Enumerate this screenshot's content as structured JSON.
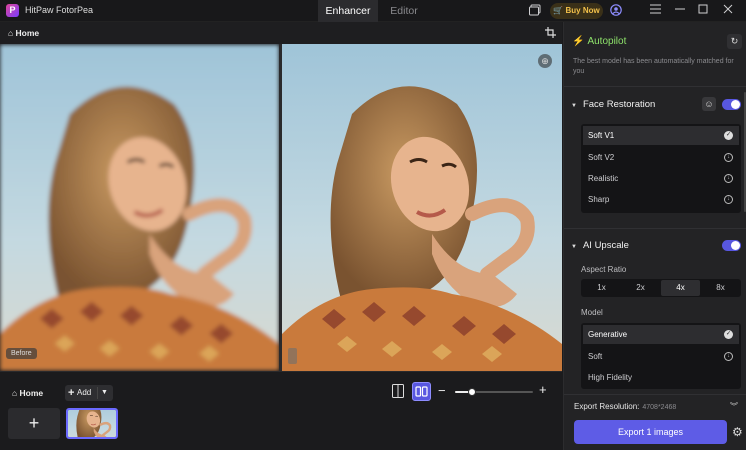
{
  "titlebar": {
    "app_name": "HitPaw FotorPea",
    "tabs": [
      {
        "label": "Enhancer",
        "active": true
      },
      {
        "label": "Editor",
        "active": false
      }
    ],
    "buy_now": "Buy Now"
  },
  "toolbar": {
    "home": "Home"
  },
  "preview": {
    "before_label": "Before"
  },
  "bottom": {
    "home": "Home",
    "add": "Add",
    "zoom_level": 0.22
  },
  "panel": {
    "autopilot": {
      "title": "Autopilot",
      "description": "The best model has been automatically matched for you"
    },
    "face_restoration": {
      "title": "Face Restoration",
      "enabled": true,
      "options": [
        {
          "label": "Soft V1",
          "selected": true
        },
        {
          "label": "Soft V2",
          "selected": false
        },
        {
          "label": "Realistic",
          "selected": false
        },
        {
          "label": "Sharp",
          "selected": false
        }
      ]
    },
    "ai_upscale": {
      "title": "AI Upscale",
      "enabled": true,
      "aspect_ratio_label": "Aspect Ratio",
      "ratios": [
        "1x",
        "2x",
        "4x",
        "8x"
      ],
      "selected_ratio": "4x",
      "model_label": "Model",
      "models": [
        {
          "label": "Generative",
          "selected": true
        },
        {
          "label": "Soft",
          "selected": false
        },
        {
          "label": "High Fidelity",
          "selected": false
        }
      ]
    },
    "export": {
      "resolution_label": "Export Resolution:",
      "resolution_value": "4708*2468",
      "button": "Export 1 images"
    }
  },
  "colors": {
    "accent": "#5e5ce6",
    "autopilot_green": "#8ee36b",
    "buy_now": "#f2c04a"
  }
}
